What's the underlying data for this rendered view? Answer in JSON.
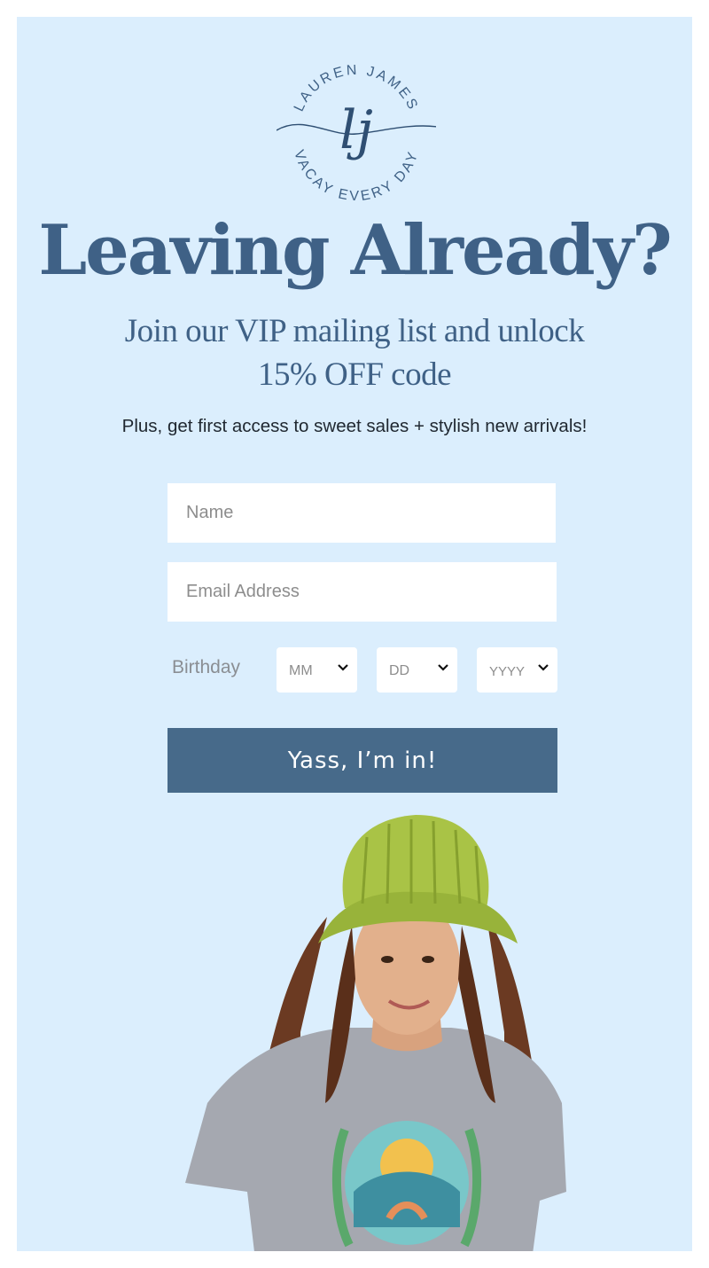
{
  "logo": {
    "top_text": "LAUREN JAMES",
    "bottom_text": "VACAY EVERY DAY",
    "monogram": "lj"
  },
  "headline": "Leaving Already?",
  "subhead": {
    "line1": "Join our VIP mailing list and unlock",
    "line2": "15% OFF code"
  },
  "promo_text": "Plus, get first access to sweet sales + stylish new arrivals!",
  "form": {
    "name_placeholder": "Name",
    "email_placeholder": "Email Address",
    "birthday_label": "Birthday",
    "month_placeholder": "MM",
    "day_placeholder": "DD",
    "year_placeholder": "YYYY",
    "submit_label": "Yass, I’m in!"
  },
  "colors": {
    "panel_bg": "#dbeefd",
    "brand_blue": "#3f6186",
    "button_bg": "#476a8a"
  }
}
